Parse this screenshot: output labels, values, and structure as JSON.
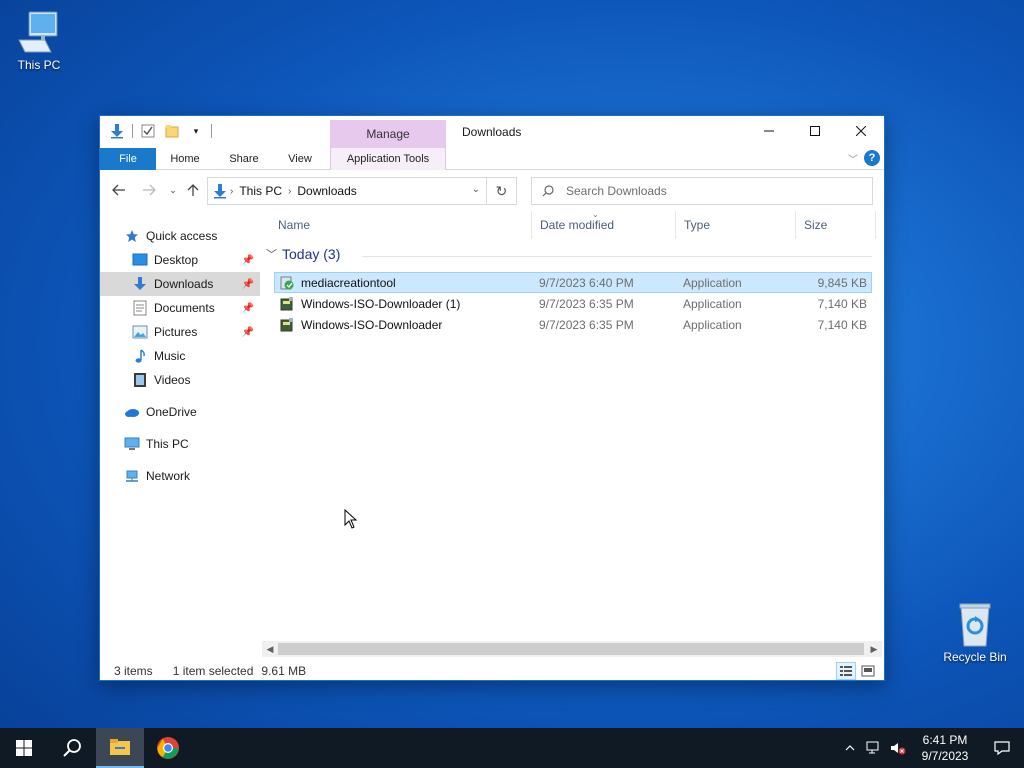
{
  "desktop": {
    "icons": [
      {
        "label": "This PC",
        "icon": "computer-icon"
      },
      {
        "label": "Recycle Bin",
        "icon": "recycle-bin-icon"
      }
    ]
  },
  "window": {
    "title": "Downloads",
    "contextual_tab_group": "Manage",
    "ribbon_tabs": [
      "File",
      "Home",
      "Share",
      "View",
      "Application Tools"
    ]
  },
  "navigation": {
    "breadcrumb": [
      "This PC",
      "Downloads"
    ],
    "search_placeholder": "Search Downloads"
  },
  "sidebar": {
    "quick_access": "Quick access",
    "pinned": [
      {
        "label": "Desktop",
        "icon": "desktop-folder-icon",
        "pinned": true
      },
      {
        "label": "Downloads",
        "icon": "downloads-folder-icon",
        "pinned": true,
        "selected": true
      },
      {
        "label": "Documents",
        "icon": "documents-folder-icon",
        "pinned": true
      },
      {
        "label": "Pictures",
        "icon": "pictures-folder-icon",
        "pinned": true
      },
      {
        "label": "Music",
        "icon": "music-folder-icon",
        "pinned": false
      },
      {
        "label": "Videos",
        "icon": "videos-folder-icon",
        "pinned": false
      }
    ],
    "onedrive": "OneDrive",
    "this_pc": "This PC",
    "network": "Network"
  },
  "file_list": {
    "columns": [
      "Name",
      "Date modified",
      "Type",
      "Size"
    ],
    "group": "Today (3)",
    "files": [
      {
        "name": "mediacreationtool",
        "date": "9/7/2023 6:40 PM",
        "type": "Application",
        "size": "9,845 KB",
        "selected": true
      },
      {
        "name": "Windows-ISO-Downloader (1)",
        "date": "9/7/2023 6:35 PM",
        "type": "Application",
        "size": "7,140 KB",
        "selected": false
      },
      {
        "name": "Windows-ISO-Downloader",
        "date": "9/7/2023 6:35 PM",
        "type": "Application",
        "size": "7,140 KB",
        "selected": false
      }
    ]
  },
  "status_bar": {
    "item_count": "3 items",
    "selection": "1 item selected",
    "selection_size": "9.61 MB"
  },
  "taskbar": {
    "time": "6:41 PM",
    "date": "9/7/2023"
  },
  "colors": {
    "accent": "#1979ca",
    "selection": "#cce8ff",
    "manage_tab": "#e8c9ee",
    "taskbar": "#101a24"
  }
}
